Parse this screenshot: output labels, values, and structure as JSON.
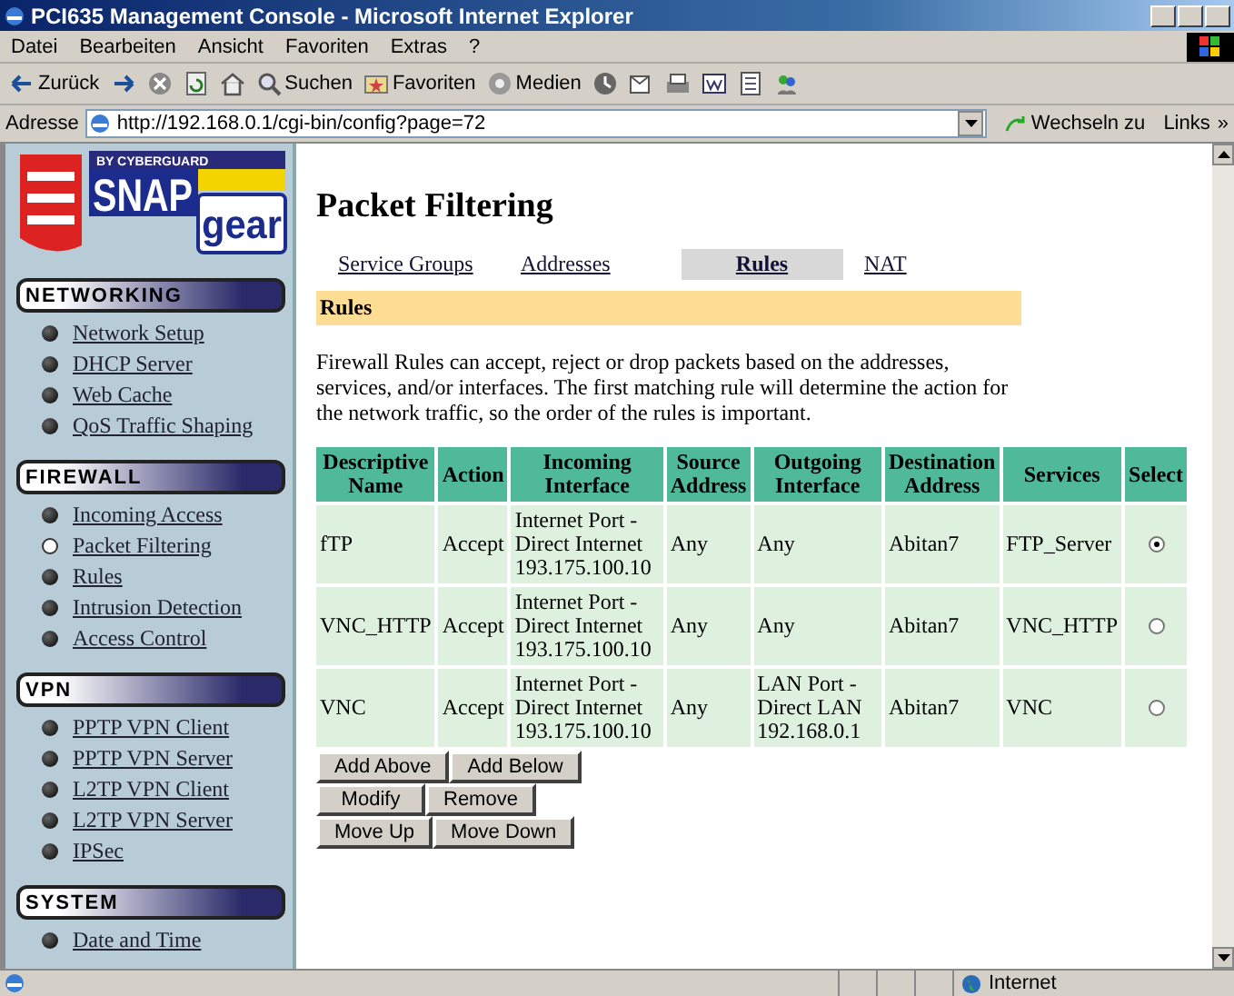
{
  "window": {
    "title": "PCI635 Management Console - Microsoft Internet Explorer"
  },
  "menu": [
    "Datei",
    "Bearbeiten",
    "Ansicht",
    "Favoriten",
    "Extras",
    "?"
  ],
  "toolbar": [
    {
      "kind": "back",
      "label": "Zurück"
    },
    {
      "kind": "forward"
    },
    {
      "kind": "stop"
    },
    {
      "kind": "refresh"
    },
    {
      "kind": "home"
    },
    {
      "kind": "search",
      "label": "Suchen"
    },
    {
      "kind": "favorites",
      "label": "Favoriten"
    },
    {
      "kind": "media",
      "label": "Medien"
    },
    {
      "kind": "history"
    },
    {
      "kind": "mail"
    },
    {
      "kind": "print"
    },
    {
      "kind": "edit"
    },
    {
      "kind": "discuss"
    },
    {
      "kind": "messenger"
    }
  ],
  "address": {
    "label": "Adresse",
    "value": "http://192.168.0.1/cgi-bin/config?page=72",
    "go": "Wechseln zu",
    "links": "Links",
    "links_arrow": "»"
  },
  "logo": {
    "tagline": "BY CYBERGUARD",
    "name_1": "SNAP",
    "name_2": "gear"
  },
  "sidebar": [
    {
      "title": "NETWORKING",
      "items": [
        {
          "label": "Network Setup",
          "selected": false
        },
        {
          "label": "DHCP Server",
          "selected": false
        },
        {
          "label": "Web Cache",
          "selected": false
        },
        {
          "label": "QoS Traffic Shaping",
          "selected": false
        }
      ]
    },
    {
      "title": "FIREWALL",
      "items": [
        {
          "label": "Incoming Access",
          "selected": false
        },
        {
          "label": "Packet Filtering",
          "selected": true
        },
        {
          "label": "Rules",
          "selected": false
        },
        {
          "label": "Intrusion Detection",
          "selected": false
        },
        {
          "label": "Access Control",
          "selected": false
        }
      ]
    },
    {
      "title": "VPN",
      "items": [
        {
          "label": "PPTP VPN Client",
          "selected": false
        },
        {
          "label": "PPTP VPN Server",
          "selected": false
        },
        {
          "label": "L2TP VPN Client",
          "selected": false
        },
        {
          "label": "L2TP VPN Server",
          "selected": false
        },
        {
          "label": "IPSec",
          "selected": false
        }
      ]
    },
    {
      "title": "SYSTEM",
      "items": [
        {
          "label": "Date and Time",
          "selected": false
        }
      ]
    }
  ],
  "page": {
    "title": "Packet Filtering",
    "tabs": [
      {
        "label": "Service Groups",
        "selected": false
      },
      {
        "label": "Addresses",
        "selected": false
      },
      {
        "label": "Rules",
        "selected": true
      },
      {
        "label": "NAT",
        "selected": false
      }
    ],
    "section": "Rules",
    "description": "Firewall Rules can accept, reject or drop packets based on the addresses, services, and/or interfaces. The first matching rule will determine the action for the network traffic, so the order of the rules is important.",
    "table": {
      "columns": [
        "Descriptive Name",
        "Action",
        "Incoming Interface",
        "Source Address",
        "Outgoing Interface",
        "Destination Address",
        "Services",
        "Select"
      ],
      "rows": [
        {
          "cells": [
            "fTP",
            "Accept",
            "Internet Port - Direct Internet 193.175.100.10",
            "Any",
            "Any",
            "Abitan7",
            "FTP_Server"
          ],
          "selected": true
        },
        {
          "cells": [
            "VNC_HTTP",
            "Accept",
            "Internet Port - Direct Internet 193.175.100.10",
            "Any",
            "Any",
            "Abitan7",
            "VNC_HTTP"
          ],
          "selected": false
        },
        {
          "cells": [
            "VNC",
            "Accept",
            "Internet Port - Direct Internet 193.175.100.10",
            "Any",
            "LAN Port - Direct LAN 192.168.0.1",
            "Abitan7",
            "VNC"
          ],
          "selected": false
        }
      ]
    },
    "button_rows": [
      [
        "Add Above",
        "Add Below"
      ],
      [
        "Modify",
        "Remove"
      ],
      [
        "Move Up",
        "Move Down"
      ]
    ]
  },
  "status_bar": {
    "zone": "Internet"
  }
}
